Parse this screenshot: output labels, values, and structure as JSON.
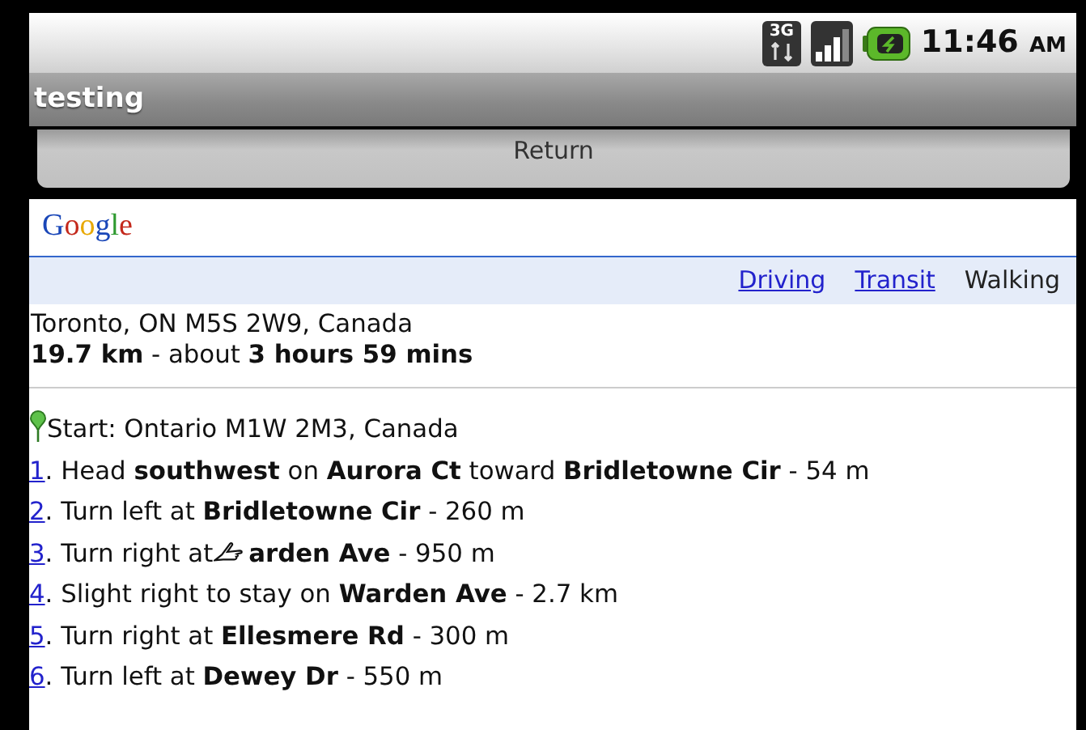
{
  "status_bar": {
    "network": "3G",
    "time": "11:46",
    "ampm": "AM"
  },
  "app_title": "testing",
  "return_button": "Return",
  "logo": "Google",
  "modes": [
    {
      "label": "Driving",
      "selected": false
    },
    {
      "label": "Transit",
      "selected": false
    },
    {
      "label": "Walking",
      "selected": true
    }
  ],
  "destination": "Toronto, ON M5S 2W9, Canada",
  "summary": "**19.7 km** - about **3 hours 59 mins**",
  "start": "Start: Ontario M1W 2M3, Canada",
  "steps": [
    {
      "number": "1",
      "text": ". Head **southwest** on **Aurora Ct** toward **Bridletowne Cir** - 54 m"
    },
    {
      "number": "2",
      "text": ". Turn left at **Bridletowne Cir** - 260 m"
    },
    {
      "number": "3",
      "text": ". Turn right at",
      "cursor": true,
      "text_after": "**arden Ave** - 950 m"
    },
    {
      "number": "4",
      "text": ". Slight right to stay on **Warden Ave** - 2.7 km"
    },
    {
      "number": "5",
      "text": ". Turn right at **Ellesmere Rd** - 300 m"
    },
    {
      "number": "6",
      "text": ". Turn left at **Dewey Dr** - 550 m"
    }
  ]
}
